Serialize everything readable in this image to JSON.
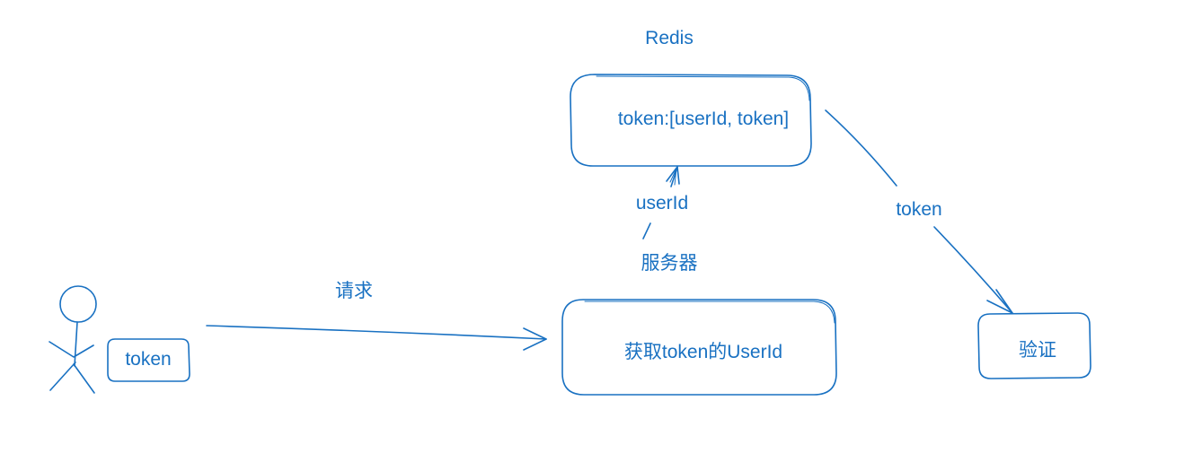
{
  "diagram": {
    "stroke_color": "#1971c2",
    "background": "#ffffff",
    "nodes": {
      "redis": {
        "title": "Redis",
        "content": "token:[userId, token]"
      },
      "server": {
        "title": "服务器",
        "content": "获取token的UserId"
      },
      "client": {
        "icon": "stick-figure-icon",
        "token_label": "token"
      },
      "verify": {
        "content": "验证"
      }
    },
    "edges": {
      "request": "请求",
      "server_to_redis": "userId",
      "redis_to_verify": "token"
    }
  }
}
